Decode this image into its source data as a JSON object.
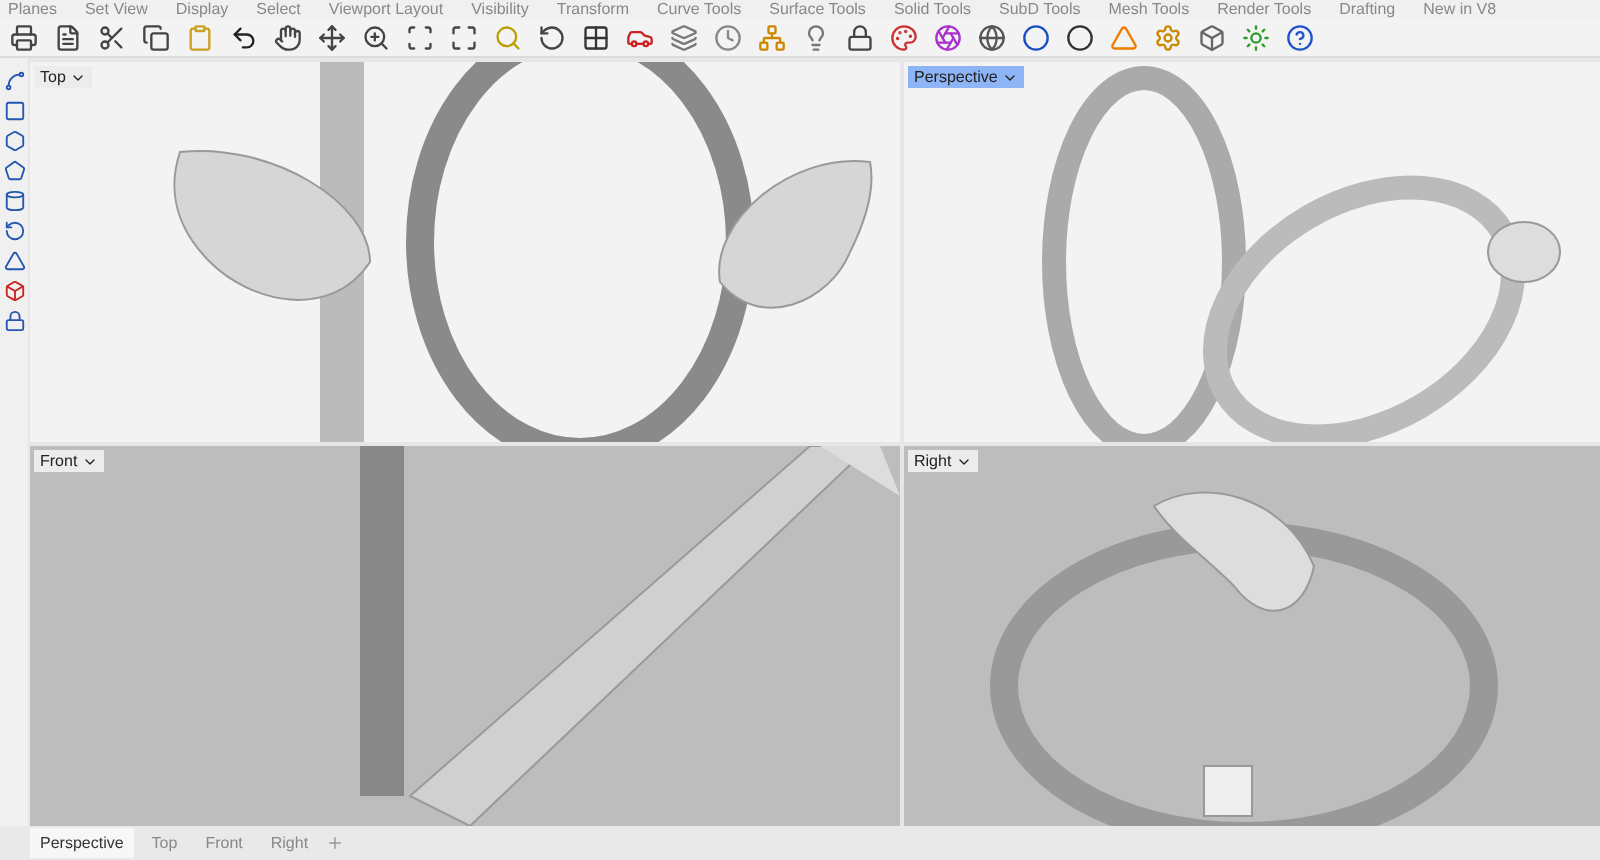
{
  "menu_tabs": [
    "Planes",
    "Set View",
    "Display",
    "Select",
    "Viewport Layout",
    "Visibility",
    "Transform",
    "Curve Tools",
    "Surface Tools",
    "Solid Tools",
    "SubD Tools",
    "Mesh Tools",
    "Render Tools",
    "Drafting",
    "New in V8"
  ],
  "viewports": [
    {
      "label": "Top",
      "selected": false,
      "kind": "top"
    },
    {
      "label": "Perspective",
      "selected": true,
      "kind": "perspective"
    },
    {
      "label": "Front",
      "selected": false,
      "kind": "front"
    },
    {
      "label": "Right",
      "selected": false,
      "kind": "right"
    }
  ],
  "view_tabs": [
    {
      "label": "Perspective",
      "selected": true
    },
    {
      "label": "Top",
      "selected": false
    },
    {
      "label": "Front",
      "selected": false
    },
    {
      "label": "Right",
      "selected": false
    }
  ]
}
